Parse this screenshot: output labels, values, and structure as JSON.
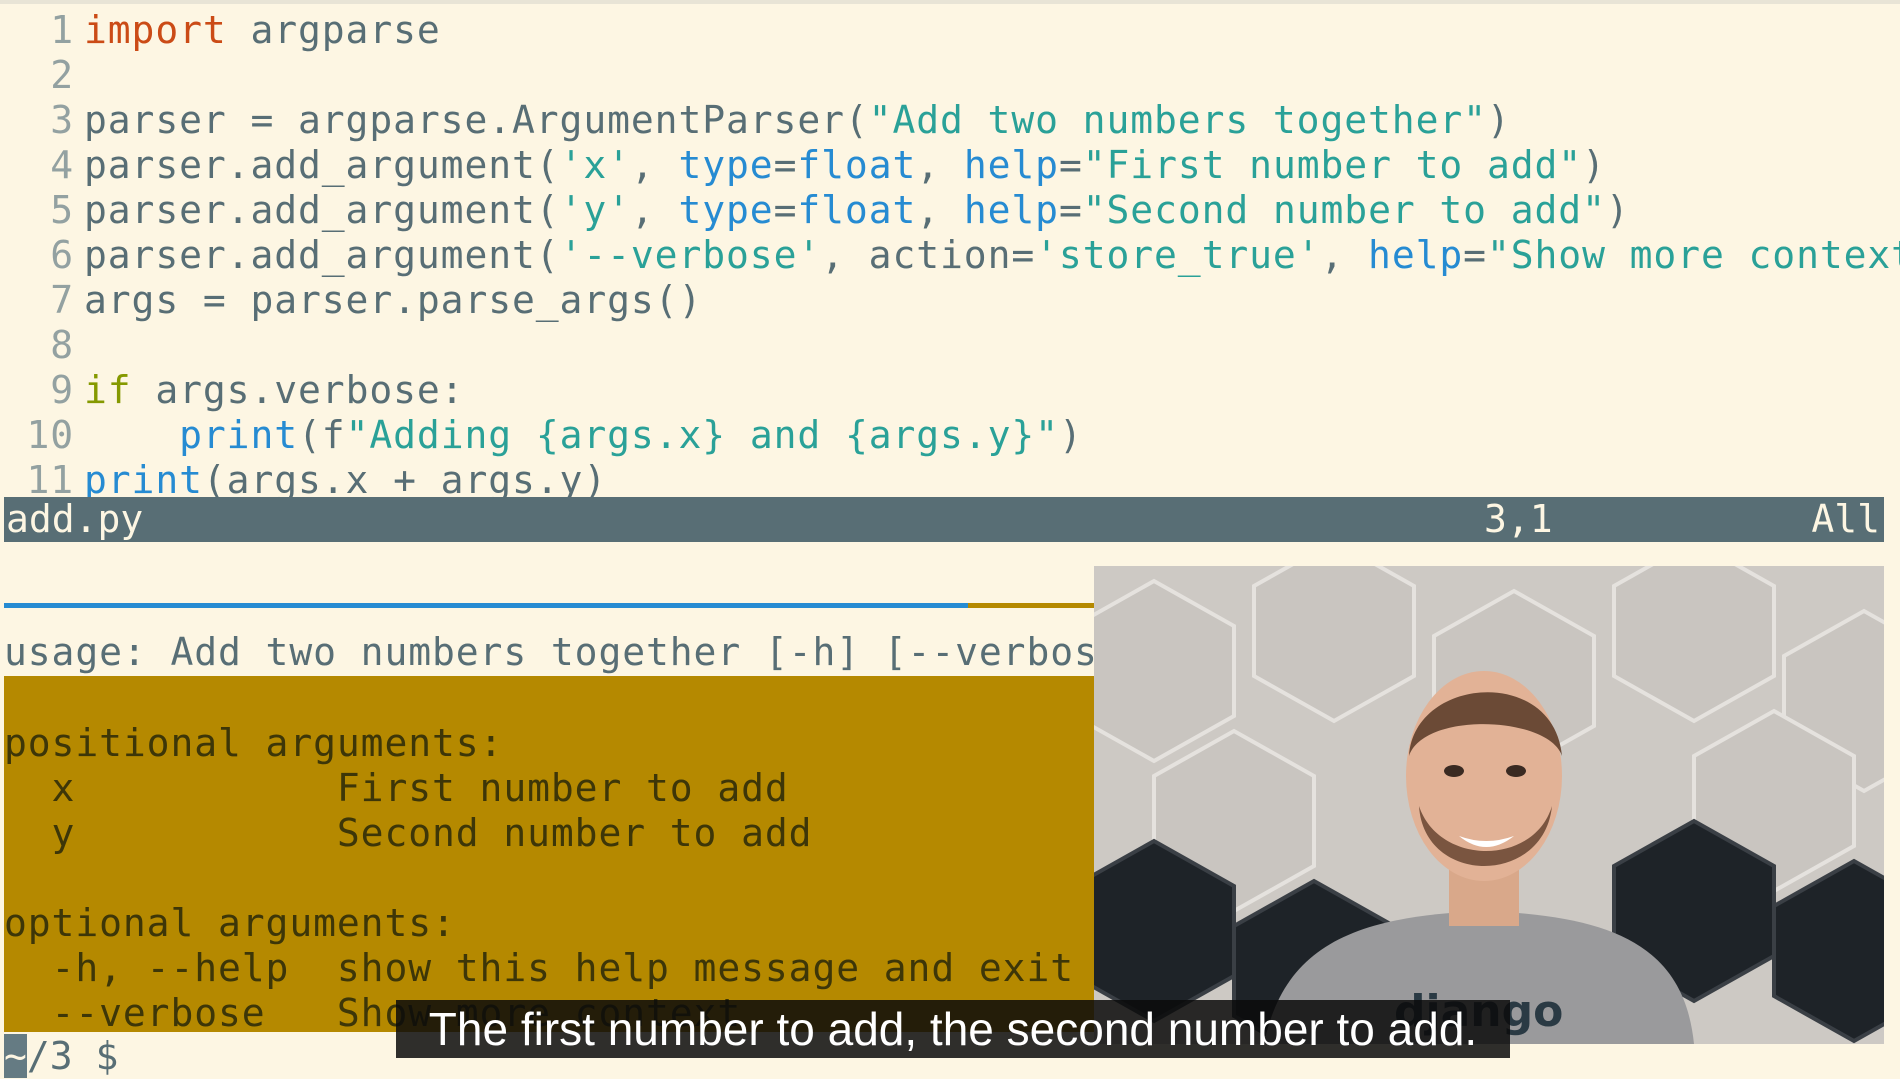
{
  "editor": {
    "lines": [
      {
        "num": "1",
        "tokens": [
          {
            "t": "import",
            "c": "c-kw-orange"
          },
          {
            "t": " argparse",
            "c": "c-txt"
          }
        ]
      },
      {
        "num": "2",
        "tokens": []
      },
      {
        "num": "3",
        "tokens": [
          {
            "t": "parser = argparse.ArgumentParser(",
            "c": "c-txt"
          },
          {
            "t": "\"Add two numbers together\"",
            "c": "c-str"
          },
          {
            "t": ")",
            "c": "c-txt"
          }
        ]
      },
      {
        "num": "4",
        "tokens": [
          {
            "t": "parser.add_argument(",
            "c": "c-txt"
          },
          {
            "t": "'x'",
            "c": "c-str"
          },
          {
            "t": ", ",
            "c": "c-txt"
          },
          {
            "t": "type",
            "c": "c-builtin"
          },
          {
            "t": "=",
            "c": "c-txt"
          },
          {
            "t": "float",
            "c": "c-builtin"
          },
          {
            "t": ", ",
            "c": "c-txt"
          },
          {
            "t": "help",
            "c": "c-builtin"
          },
          {
            "t": "=",
            "c": "c-txt"
          },
          {
            "t": "\"First number to add\"",
            "c": "c-str"
          },
          {
            "t": ")",
            "c": "c-txt"
          }
        ]
      },
      {
        "num": "5",
        "tokens": [
          {
            "t": "parser.add_argument(",
            "c": "c-txt"
          },
          {
            "t": "'y'",
            "c": "c-str"
          },
          {
            "t": ", ",
            "c": "c-txt"
          },
          {
            "t": "type",
            "c": "c-builtin"
          },
          {
            "t": "=",
            "c": "c-txt"
          },
          {
            "t": "float",
            "c": "c-builtin"
          },
          {
            "t": ", ",
            "c": "c-txt"
          },
          {
            "t": "help",
            "c": "c-builtin"
          },
          {
            "t": "=",
            "c": "c-txt"
          },
          {
            "t": "\"Second number to add\"",
            "c": "c-str"
          },
          {
            "t": ")",
            "c": "c-txt"
          }
        ]
      },
      {
        "num": "6",
        "tokens": [
          {
            "t": "parser.add_argument(",
            "c": "c-txt"
          },
          {
            "t": "'--verbose'",
            "c": "c-str"
          },
          {
            "t": ", action=",
            "c": "c-txt"
          },
          {
            "t": "'store_true'",
            "c": "c-str"
          },
          {
            "t": ", ",
            "c": "c-txt"
          },
          {
            "t": "help",
            "c": "c-builtin"
          },
          {
            "t": "=",
            "c": "c-txt"
          },
          {
            "t": "\"Show more context\"",
            "c": "c-str"
          },
          {
            "t": ")",
            "c": "c-txt"
          }
        ]
      },
      {
        "num": "7",
        "tokens": [
          {
            "t": "args = parser.parse_args()",
            "c": "c-txt"
          }
        ]
      },
      {
        "num": "8",
        "tokens": []
      },
      {
        "num": "9",
        "tokens": [
          {
            "t": "if",
            "c": "c-kw-green"
          },
          {
            "t": " args.verbose:",
            "c": "c-txt"
          }
        ]
      },
      {
        "num": "10",
        "tokens": [
          {
            "t": "    ",
            "c": "c-txt"
          },
          {
            "t": "print",
            "c": "c-builtin"
          },
          {
            "t": "(f",
            "c": "c-txt"
          },
          {
            "t": "\"Adding ",
            "c": "c-str"
          },
          {
            "t": "{args.x}",
            "c": "c-str"
          },
          {
            "t": " and ",
            "c": "c-str"
          },
          {
            "t": "{args.y}",
            "c": "c-str"
          },
          {
            "t": "\"",
            "c": "c-str"
          },
          {
            "t": ")",
            "c": "c-txt"
          }
        ]
      },
      {
        "num": "11",
        "tokens": [
          {
            "t": "print",
            "c": "c-builtin"
          },
          {
            "t": "(args.x + args.y)",
            "c": "c-txt"
          }
        ]
      }
    ]
  },
  "statusbar": {
    "filename": "add.py",
    "position": "3,1",
    "scroll": "All"
  },
  "terminal": {
    "usage": "usage: Add two numbers together [-h] [--verbose]",
    "help_lines": [
      "",
      "positional arguments:",
      "  x           First number to add",
      "  y           Second number to add",
      "",
      "optional arguments:",
      "  -h, --help  show this help message and exit",
      "  --verbose   Show more context"
    ],
    "prompt_cursor": "~",
    "prompt_rest": "/3 $"
  },
  "caption": {
    "text": "The first number to add, the second number to add."
  },
  "webcam": {
    "shirt_text": "django"
  }
}
